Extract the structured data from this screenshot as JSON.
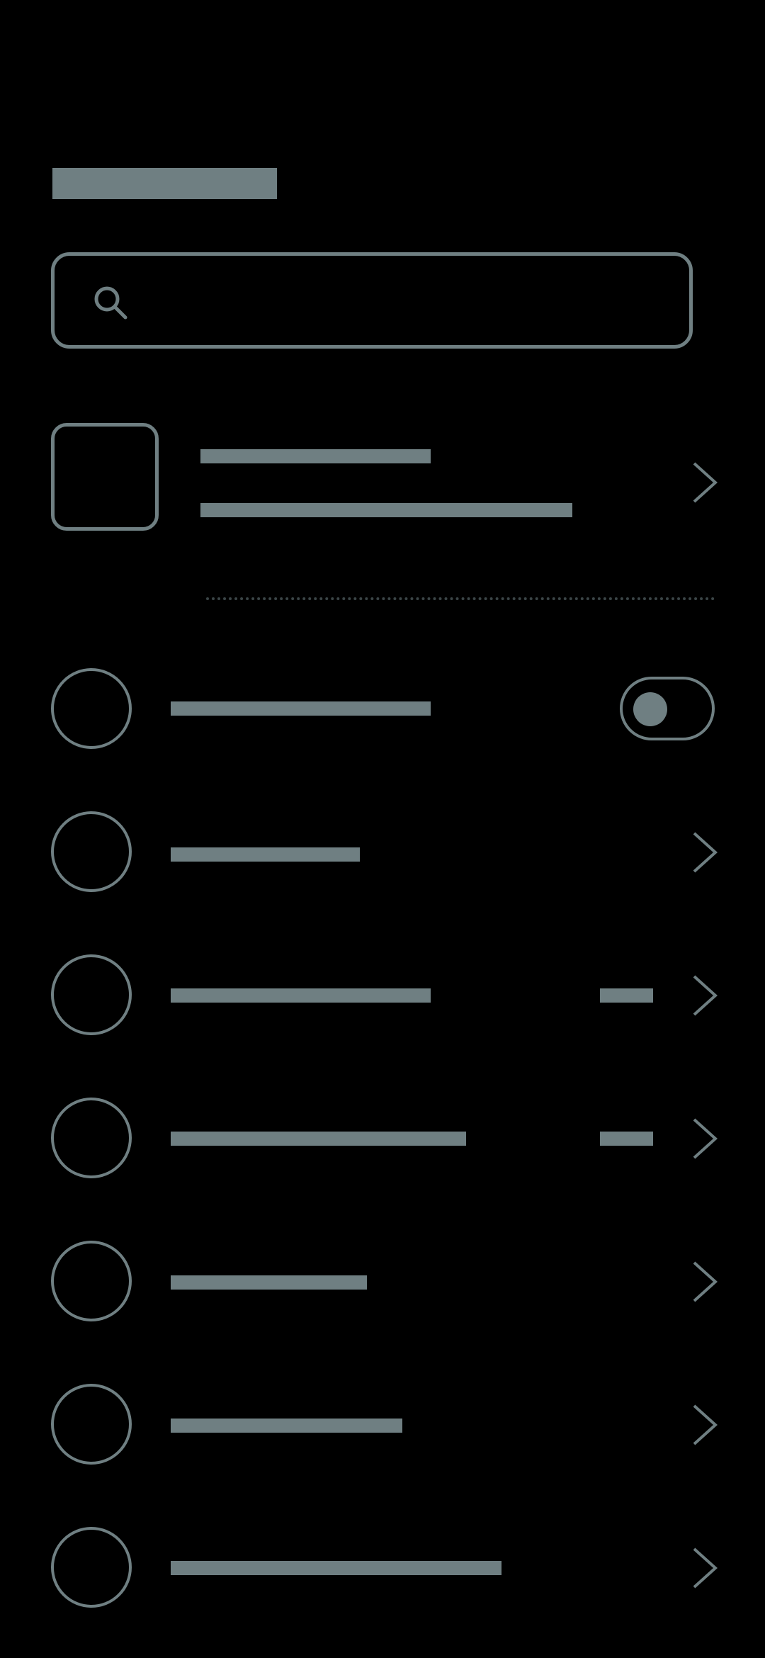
{
  "colors": {
    "background": "#000000",
    "placeholder": "#6f7f82",
    "divider": "#3b4547"
  },
  "header": {
    "title_placeholder": "title-bar"
  },
  "search": {
    "icon": "search-icon",
    "value": "",
    "placeholder": ""
  },
  "profile": {
    "avatar": "square-avatar",
    "icon": "chevron-right-icon"
  },
  "settings": {
    "items": [
      {
        "icon": "circle-icon",
        "control": "toggle",
        "toggle_on": true
      },
      {
        "icon": "circle-icon",
        "control": "chevron-right-icon"
      },
      {
        "icon": "circle-icon",
        "control": "chevron-right-icon",
        "has_value": true
      },
      {
        "icon": "circle-icon",
        "control": "chevron-right-icon",
        "has_value": true
      },
      {
        "icon": "circle-icon",
        "control": "chevron-right-icon"
      },
      {
        "icon": "circle-icon",
        "control": "chevron-right-icon"
      },
      {
        "icon": "circle-icon",
        "control": "chevron-right-icon"
      }
    ]
  }
}
